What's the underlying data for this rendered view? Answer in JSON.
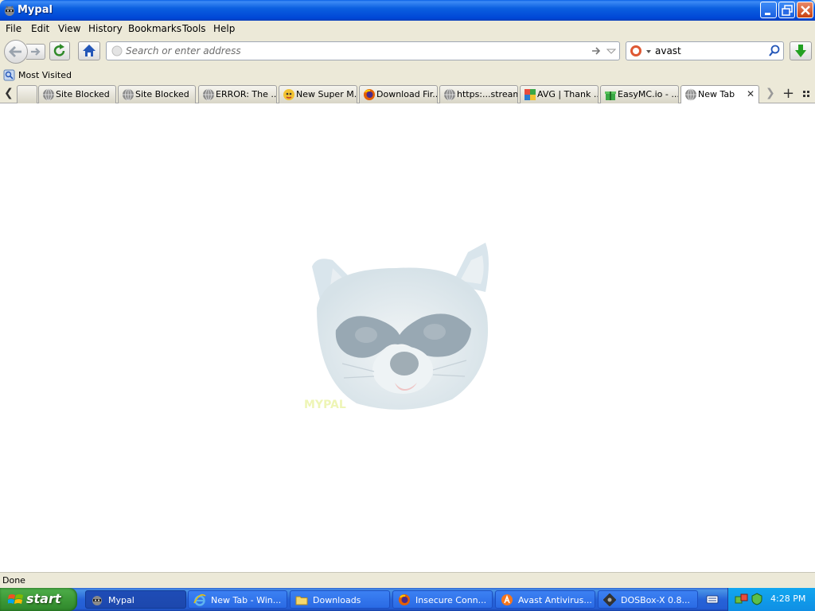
{
  "window": {
    "title": "Mypal",
    "icon": "raccoon-icon"
  },
  "menu": {
    "items": [
      "File",
      "Edit",
      "View",
      "History",
      "Bookmarks",
      "Tools",
      "Help"
    ]
  },
  "navigation": {
    "url_placeholder": "Search or enter address",
    "url_value": "",
    "search_value": "avast",
    "search_engine_icon": "duckduckgo-icon"
  },
  "bookmarks": {
    "items": [
      {
        "label": "Most Visited",
        "icon": "most-visited-icon"
      }
    ]
  },
  "tabs": {
    "items": [
      {
        "label": "",
        "icon": "",
        "active": false
      },
      {
        "label": "Site Blocked",
        "icon": "globe-icon",
        "active": false
      },
      {
        "label": "Site Blocked",
        "icon": "globe-icon",
        "active": false
      },
      {
        "label": "ERROR: The ...",
        "icon": "globe-icon",
        "active": false
      },
      {
        "label": "New Super M...",
        "icon": "mario-icon",
        "active": false
      },
      {
        "label": "Download Fir...",
        "icon": "firefox-icon",
        "active": false
      },
      {
        "label": "https:...stream",
        "icon": "globe-icon",
        "active": false
      },
      {
        "label": "AVG | Thank ...",
        "icon": "avg-icon",
        "active": false
      },
      {
        "label": "EasyMC.io - ...",
        "icon": "gift-icon",
        "active": false
      },
      {
        "label": "New Tab",
        "icon": "globe-icon",
        "active": true
      }
    ]
  },
  "content": {
    "logo": "mypal-raccoon-logo",
    "logo_text": "MYPAL"
  },
  "status": {
    "text": "Done"
  },
  "taskbar": {
    "start_label": "start",
    "tasks": [
      {
        "label": "Mypal",
        "icon": "raccoon-icon",
        "active": true
      },
      {
        "label": "New Tab - Win...",
        "icon": "ie-icon",
        "active": false
      },
      {
        "label": "Downloads",
        "icon": "folder-icon",
        "active": false
      },
      {
        "label": "Insecure Conn...",
        "icon": "firefox-icon",
        "active": false
      },
      {
        "label": "Avast Antivirus...",
        "icon": "avast-icon",
        "active": false
      },
      {
        "label": "DOSBox-X 0.8...",
        "icon": "dosbox-icon",
        "active": false
      }
    ],
    "clock": "4:28 PM"
  },
  "colors": {
    "titlebar": "#0054e3",
    "taskbar": "#245dd4",
    "start": "#3d9a38",
    "tray": "#0f8fe4"
  }
}
